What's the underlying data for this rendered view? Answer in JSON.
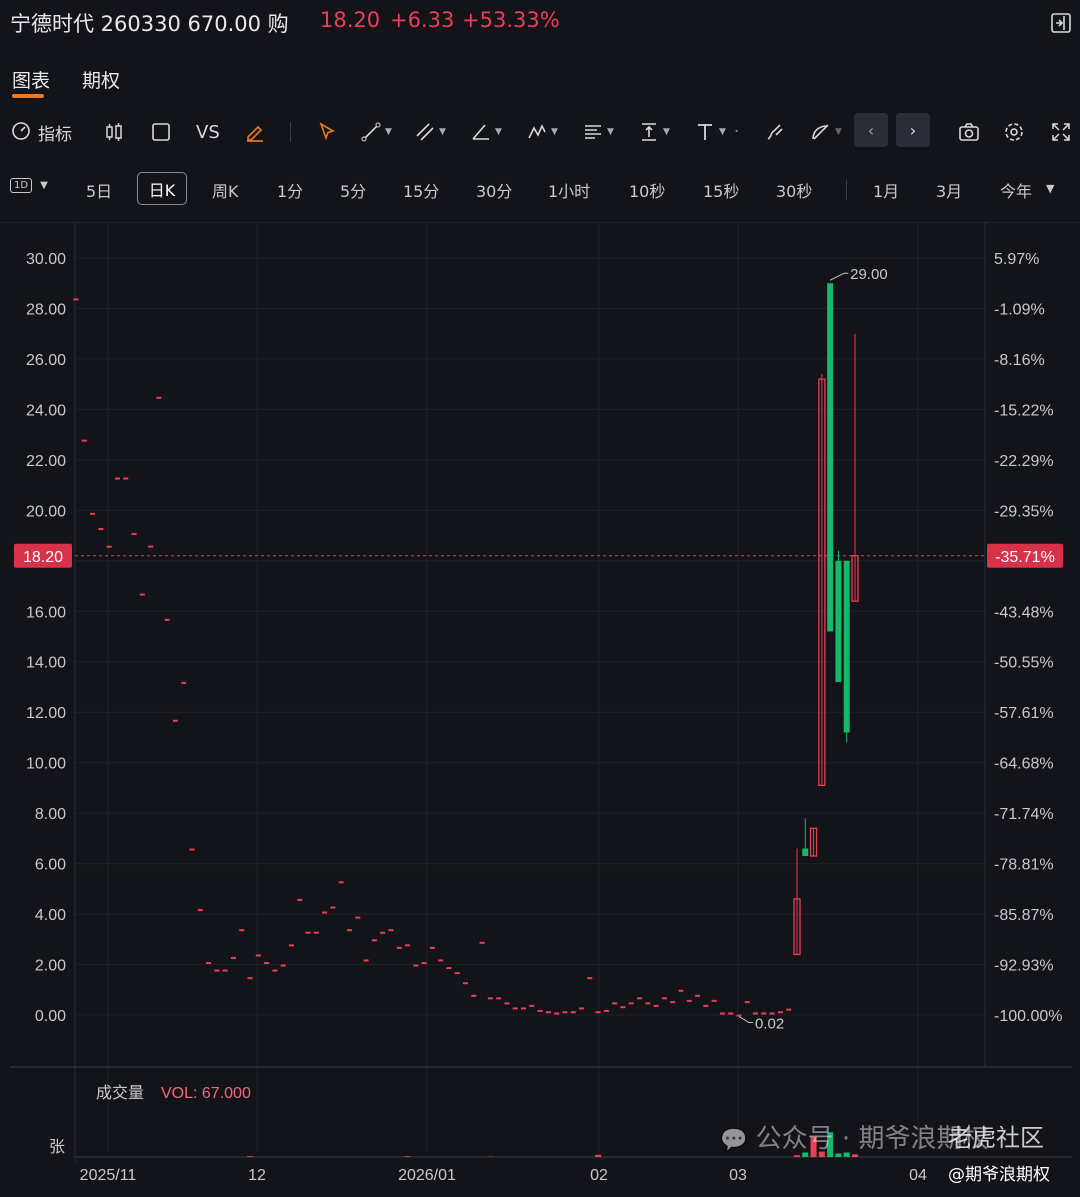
{
  "header": {
    "title": "宁德时代 260330 670.00 购",
    "price": "18.20",
    "change": "+6.33",
    "change_pct": "+53.33%"
  },
  "tabs": [
    {
      "label": "图表",
      "active": true
    },
    {
      "label": "期权",
      "active": false
    }
  ],
  "toolbar": {
    "indicator_label": "指标",
    "vs_label": "VS"
  },
  "periods": {
    "interval_selector": "1D",
    "items": [
      "5日",
      "日K",
      "周K",
      "1分",
      "5分",
      "15分",
      "30分",
      "1小时",
      "10秒",
      "15秒",
      "30秒",
      "1月",
      "3月",
      "今年"
    ],
    "active": "日K"
  },
  "chart_data": {
    "type": "candlestick",
    "y_left_ticks": [
      "30.00",
      "28.00",
      "26.00",
      "24.00",
      "22.00",
      "20.00",
      "18.00",
      "16.00",
      "14.00",
      "12.00",
      "10.00",
      "8.00",
      "6.00",
      "4.00",
      "2.00",
      "0.00"
    ],
    "y_right_ticks": [
      "5.97%",
      "-1.09%",
      "-8.16%",
      "-15.22%",
      "-22.29%",
      "-29.35%",
      "-35.71%",
      "-43.48%",
      "-50.55%",
      "-57.61%",
      "-64.68%",
      "-71.74%",
      "-78.81%",
      "-85.87%",
      "-92.93%",
      "-100.00%"
    ],
    "ylim": [
      -2,
      31
    ],
    "current_price_label": "18.20",
    "current_pct_label": "-35.71%",
    "current_price": 18.2,
    "high_label": "29.00",
    "low_label": "0.02",
    "x_labels": [
      "2025/11",
      "12",
      "2026/01",
      "02",
      "03",
      "04"
    ],
    "volume_label": "成交量",
    "vol_text": "VOL: 67.000",
    "volume_unit": "张",
    "up_color": "#ee3d56",
    "down_color": "#16b86a",
    "candles": [
      [
        28.4,
        28.4,
        28.4,
        28.4
      ],
      [
        22.8,
        22.8,
        22.8,
        22.8
      ],
      [
        19.9,
        19.9,
        19.9,
        19.9
      ],
      [
        19.3,
        19.3,
        19.3,
        19.3
      ],
      [
        18.6,
        18.6,
        18.6,
        18.6
      ],
      [
        21.3,
        21.3,
        21.3,
        21.3
      ],
      [
        21.3,
        21.3,
        21.3,
        21.3
      ],
      [
        19.1,
        19.1,
        19.1,
        19.1
      ],
      [
        16.7,
        16.7,
        16.7,
        16.7
      ],
      [
        18.6,
        18.6,
        18.6,
        18.6
      ],
      [
        24.5,
        24.5,
        24.5,
        24.5
      ],
      [
        15.7,
        15.7,
        15.7,
        15.7
      ],
      [
        11.7,
        11.7,
        11.7,
        11.7
      ],
      [
        13.2,
        13.2,
        13.2,
        13.2
      ],
      [
        6.6,
        6.6,
        6.6,
        6.6
      ],
      [
        4.2,
        4.2,
        4.2,
        4.2
      ],
      [
        2.1,
        2.1,
        2.1,
        2.1
      ],
      [
        1.8,
        1.8,
        1.8,
        1.8
      ],
      [
        1.8,
        1.8,
        1.8,
        1.8
      ],
      [
        2.3,
        2.3,
        2.3,
        2.3
      ],
      [
        3.4,
        3.4,
        3.4,
        3.4
      ],
      [
        1.5,
        1.5,
        1.5,
        1.5
      ],
      [
        2.4,
        2.4,
        2.4,
        2.4
      ],
      [
        2.1,
        2.1,
        2.1,
        2.1
      ],
      [
        1.8,
        1.8,
        1.8,
        1.8
      ],
      [
        2.0,
        2.0,
        2.0,
        2.0
      ],
      [
        2.8,
        2.8,
        2.8,
        2.8
      ],
      [
        4.6,
        4.6,
        4.6,
        4.6
      ],
      [
        3.3,
        3.3,
        3.3,
        3.3
      ],
      [
        3.3,
        3.3,
        3.3,
        3.3
      ],
      [
        4.1,
        4.1,
        4.1,
        4.1
      ],
      [
        4.3,
        4.3,
        4.3,
        4.3
      ],
      [
        5.3,
        5.3,
        5.3,
        5.3
      ],
      [
        3.4,
        3.4,
        3.4,
        3.4
      ],
      [
        3.9,
        3.9,
        3.9,
        3.9
      ],
      [
        2.2,
        2.2,
        2.2,
        2.2
      ],
      [
        3.0,
        3.0,
        3.0,
        3.0
      ],
      [
        3.3,
        3.3,
        3.3,
        3.3
      ],
      [
        3.4,
        3.4,
        3.4,
        3.4
      ],
      [
        2.7,
        2.7,
        2.7,
        2.7
      ],
      [
        2.8,
        2.8,
        2.8,
        2.8
      ],
      [
        2.0,
        2.0,
        2.0,
        2.0
      ],
      [
        2.1,
        2.1,
        2.1,
        2.1
      ],
      [
        2.7,
        2.7,
        2.7,
        2.7
      ],
      [
        2.2,
        2.2,
        2.2,
        2.2
      ],
      [
        1.9,
        1.9,
        1.9,
        1.9
      ],
      [
        1.7,
        1.7,
        1.7,
        1.7
      ],
      [
        1.3,
        1.3,
        1.3,
        1.3
      ],
      [
        0.8,
        0.8,
        0.8,
        0.8
      ],
      [
        2.9,
        2.9,
        2.9,
        2.9
      ],
      [
        0.7,
        0.7,
        0.7,
        0.7
      ],
      [
        0.7,
        0.7,
        0.7,
        0.7
      ],
      [
        0.5,
        0.5,
        0.5,
        0.5
      ],
      [
        0.3,
        0.3,
        0.3,
        0.3
      ],
      [
        0.3,
        0.3,
        0.3,
        0.3
      ],
      [
        0.4,
        0.4,
        0.4,
        0.4
      ],
      [
        0.2,
        0.2,
        0.2,
        0.2
      ],
      [
        0.15,
        0.15,
        0.15,
        0.15
      ],
      [
        0.1,
        0.1,
        0.1,
        0.1
      ],
      [
        0.15,
        0.15,
        0.15,
        0.15
      ],
      [
        0.15,
        0.15,
        0.15,
        0.15
      ],
      [
        0.3,
        0.3,
        0.3,
        0.3
      ],
      [
        1.5,
        1.5,
        1.5,
        1.5
      ],
      [
        0.15,
        0.15,
        0.15,
        0.15
      ],
      [
        0.2,
        0.2,
        0.2,
        0.2
      ],
      [
        0.5,
        0.5,
        0.5,
        0.5
      ],
      [
        0.35,
        0.35,
        0.35,
        0.35
      ],
      [
        0.5,
        0.5,
        0.5,
        0.5
      ],
      [
        0.7,
        0.7,
        0.7,
        0.7
      ],
      [
        0.5,
        0.5,
        0.5,
        0.5
      ],
      [
        0.4,
        0.4,
        0.4,
        0.4
      ],
      [
        0.7,
        0.7,
        0.7,
        0.7
      ],
      [
        0.55,
        0.55,
        0.55,
        0.55
      ],
      [
        1.0,
        1.0,
        1.0,
        1.0
      ],
      [
        0.6,
        0.6,
        0.6,
        0.6
      ],
      [
        0.8,
        0.8,
        0.8,
        0.8
      ],
      [
        0.4,
        0.4,
        0.4,
        0.4
      ],
      [
        0.6,
        0.6,
        0.6,
        0.6
      ],
      [
        0.1,
        0.1,
        0.1,
        0.1
      ],
      [
        0.1,
        0.1,
        0.1,
        0.1
      ],
      [
        0.02,
        0.02,
        0.02,
        0.02
      ],
      [
        0.55,
        0.55,
        0.55,
        0.55
      ],
      [
        0.1,
        0.1,
        0.1,
        0.1
      ],
      [
        0.1,
        0.1,
        0.1,
        0.1
      ],
      [
        0.1,
        0.1,
        0.1,
        0.1
      ],
      [
        0.15,
        0.15,
        0.15,
        0.15
      ],
      [
        0.25,
        0.25,
        0.25,
        0.25
      ],
      [
        2.4,
        4.6,
        2.4,
        6.6
      ],
      [
        6.6,
        6.3,
        6.3,
        7.8
      ],
      [
        6.3,
        7.4,
        6.3,
        7.4
      ],
      [
        9.1,
        25.2,
        9.1,
        25.4
      ],
      [
        29.0,
        15.2,
        15.2,
        29.0
      ],
      [
        18.0,
        13.2,
        13.2,
        18.4
      ],
      [
        18.0,
        11.2,
        10.8,
        18.0
      ],
      [
        16.4,
        18.2,
        16.4,
        27.0
      ]
    ],
    "volumes": [
      0,
      0,
      0,
      0,
      0,
      0,
      0,
      0,
      0,
      0,
      0,
      0,
      0,
      0,
      0,
      0,
      0,
      0,
      0,
      0,
      0,
      2,
      0,
      0,
      0,
      0,
      0,
      0,
      0,
      0,
      0,
      0,
      0,
      0,
      0,
      0,
      0,
      0,
      0,
      0,
      2,
      0,
      0,
      0,
      0,
      0,
      0,
      0,
      0,
      0,
      1,
      0,
      0,
      0,
      0,
      0,
      0,
      0,
      0,
      0,
      0,
      0,
      0,
      5,
      0,
      0,
      0,
      0,
      0,
      0,
      0,
      0,
      0,
      0,
      0,
      0,
      0,
      0,
      0,
      0,
      0,
      0,
      0,
      0,
      0,
      0,
      0,
      4,
      10,
      45,
      12,
      55,
      8,
      10,
      6
    ]
  },
  "watermark": {
    "text": "公众号 · 期爷浪期权",
    "brand": "老虎社区",
    "handle": "@期爷浪期权"
  }
}
